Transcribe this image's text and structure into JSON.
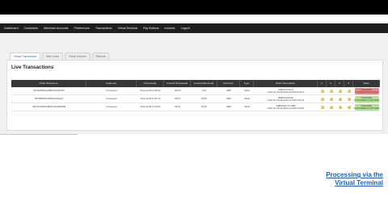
{
  "nav": {
    "items": [
      "Dashboard",
      "Customers",
      "Merchant Accounts",
      "Preferences",
      "Transactions",
      "Virtual Terminal",
      "Pay Buttons",
      "Invoices",
      "Logout"
    ]
  },
  "tabs": [
    {
      "label": "Virtual Transactions",
      "active": true
    },
    {
      "label": "Web Leads",
      "active": false
    },
    {
      "label": "Virtual Invoices",
      "active": false
    },
    {
      "label": "Refunds",
      "active": false
    }
  ],
  "panel": {
    "title": "Live Transactions"
  },
  "table": {
    "headers": [
      "Order Reference",
      "Customer",
      "Processing",
      "Amount Requested",
      "Amount Received",
      "Currency",
      "Type",
      "Order Description",
      "1",
      "2",
      "3",
      "4",
      "State"
    ],
    "rows": [
      {
        "ref": "VB-3DXBNGAQBF3JQVQTFPF",
        "customer": "A Customer",
        "date": "2014-12-09 14:48:22",
        "requested": "100.00",
        "received": "0.00",
        "currency": "GBP",
        "type": "SALE",
        "desc1": "VS/DC/VT/2147",
        "desc2": "Order ID: #LIVE-2014-12-09T14:48:22",
        "state1": "DECLINED",
        "state2": "AUTHORISATION FAILED",
        "state_kind": "failed"
      },
      {
        "ref": "VB-NBFF9KAQBRG3LNGQG",
        "customer": "A Customer",
        "date": "2014-12-09 14:36:14",
        "requested": "54.15",
        "received": "54.15",
        "currency": "GBP",
        "type": "SALE",
        "desc1": "DEBIT/CA/N/02",
        "desc2": "Order ID: #LIVE-2014-12-09T14:36:14",
        "state1": "CAPTURED",
        "state2": "AUTHORISED & CAPTURED",
        "state_kind": "ok"
      },
      {
        "ref": "VB-HPXNDHT38KRVNQAPMD3B",
        "customer": "A Customer",
        "date": "2014-12-09 14:33:51",
        "requested": "54.15",
        "received": "54.15",
        "currency": "GBP",
        "type": "SALE",
        "desc1": "DEBIT/MC/VT/1089",
        "desc2": "Order ID: #LIVE-2014-12-09T14:33:51",
        "state1": "CAPTURED",
        "state2": "AUTHORISED & CAPTURED",
        "state_kind": "ok"
      }
    ]
  },
  "caption": {
    "line1": "Processing via the",
    "line2": "Virtual Terminal"
  },
  "colors": {
    "nav_bg": "#1e1e1e",
    "table_header_bg": "#363636",
    "state_failed": "#e58b86",
    "state_ok": "#b6dc9c",
    "caption": "#1f5fb0"
  }
}
